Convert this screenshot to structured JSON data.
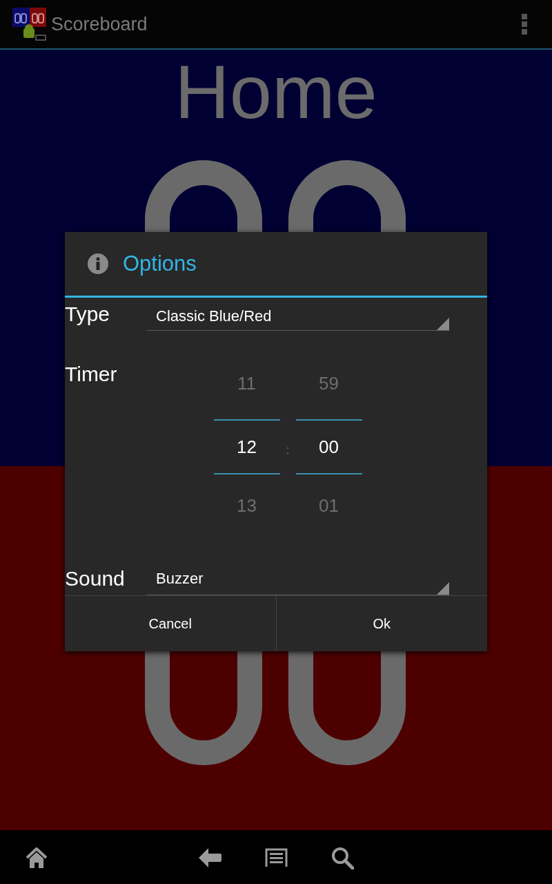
{
  "action_bar": {
    "title": "Scoreboard"
  },
  "scoreboard": {
    "home_label": "Home"
  },
  "dialog": {
    "title": "Options",
    "fields": [
      {
        "kind": "spinner",
        "label": "Type",
        "value": "Classic Blue/Red"
      },
      {
        "kind": "timer",
        "label": "Timer",
        "separator": ":",
        "pickers": [
          {
            "values": [
              {
                "text": "11",
                "selected": false
              },
              {
                "text": "12",
                "selected": true
              },
              {
                "text": "13",
                "selected": false
              }
            ]
          },
          {
            "values": [
              {
                "text": "59",
                "selected": false
              },
              {
                "text": "00",
                "selected": true
              },
              {
                "text": "01",
                "selected": false
              }
            ]
          }
        ]
      },
      {
        "kind": "spinner",
        "label": "Sound",
        "value": "Buzzer"
      }
    ],
    "buttons": [
      "Cancel",
      "Ok"
    ]
  }
}
